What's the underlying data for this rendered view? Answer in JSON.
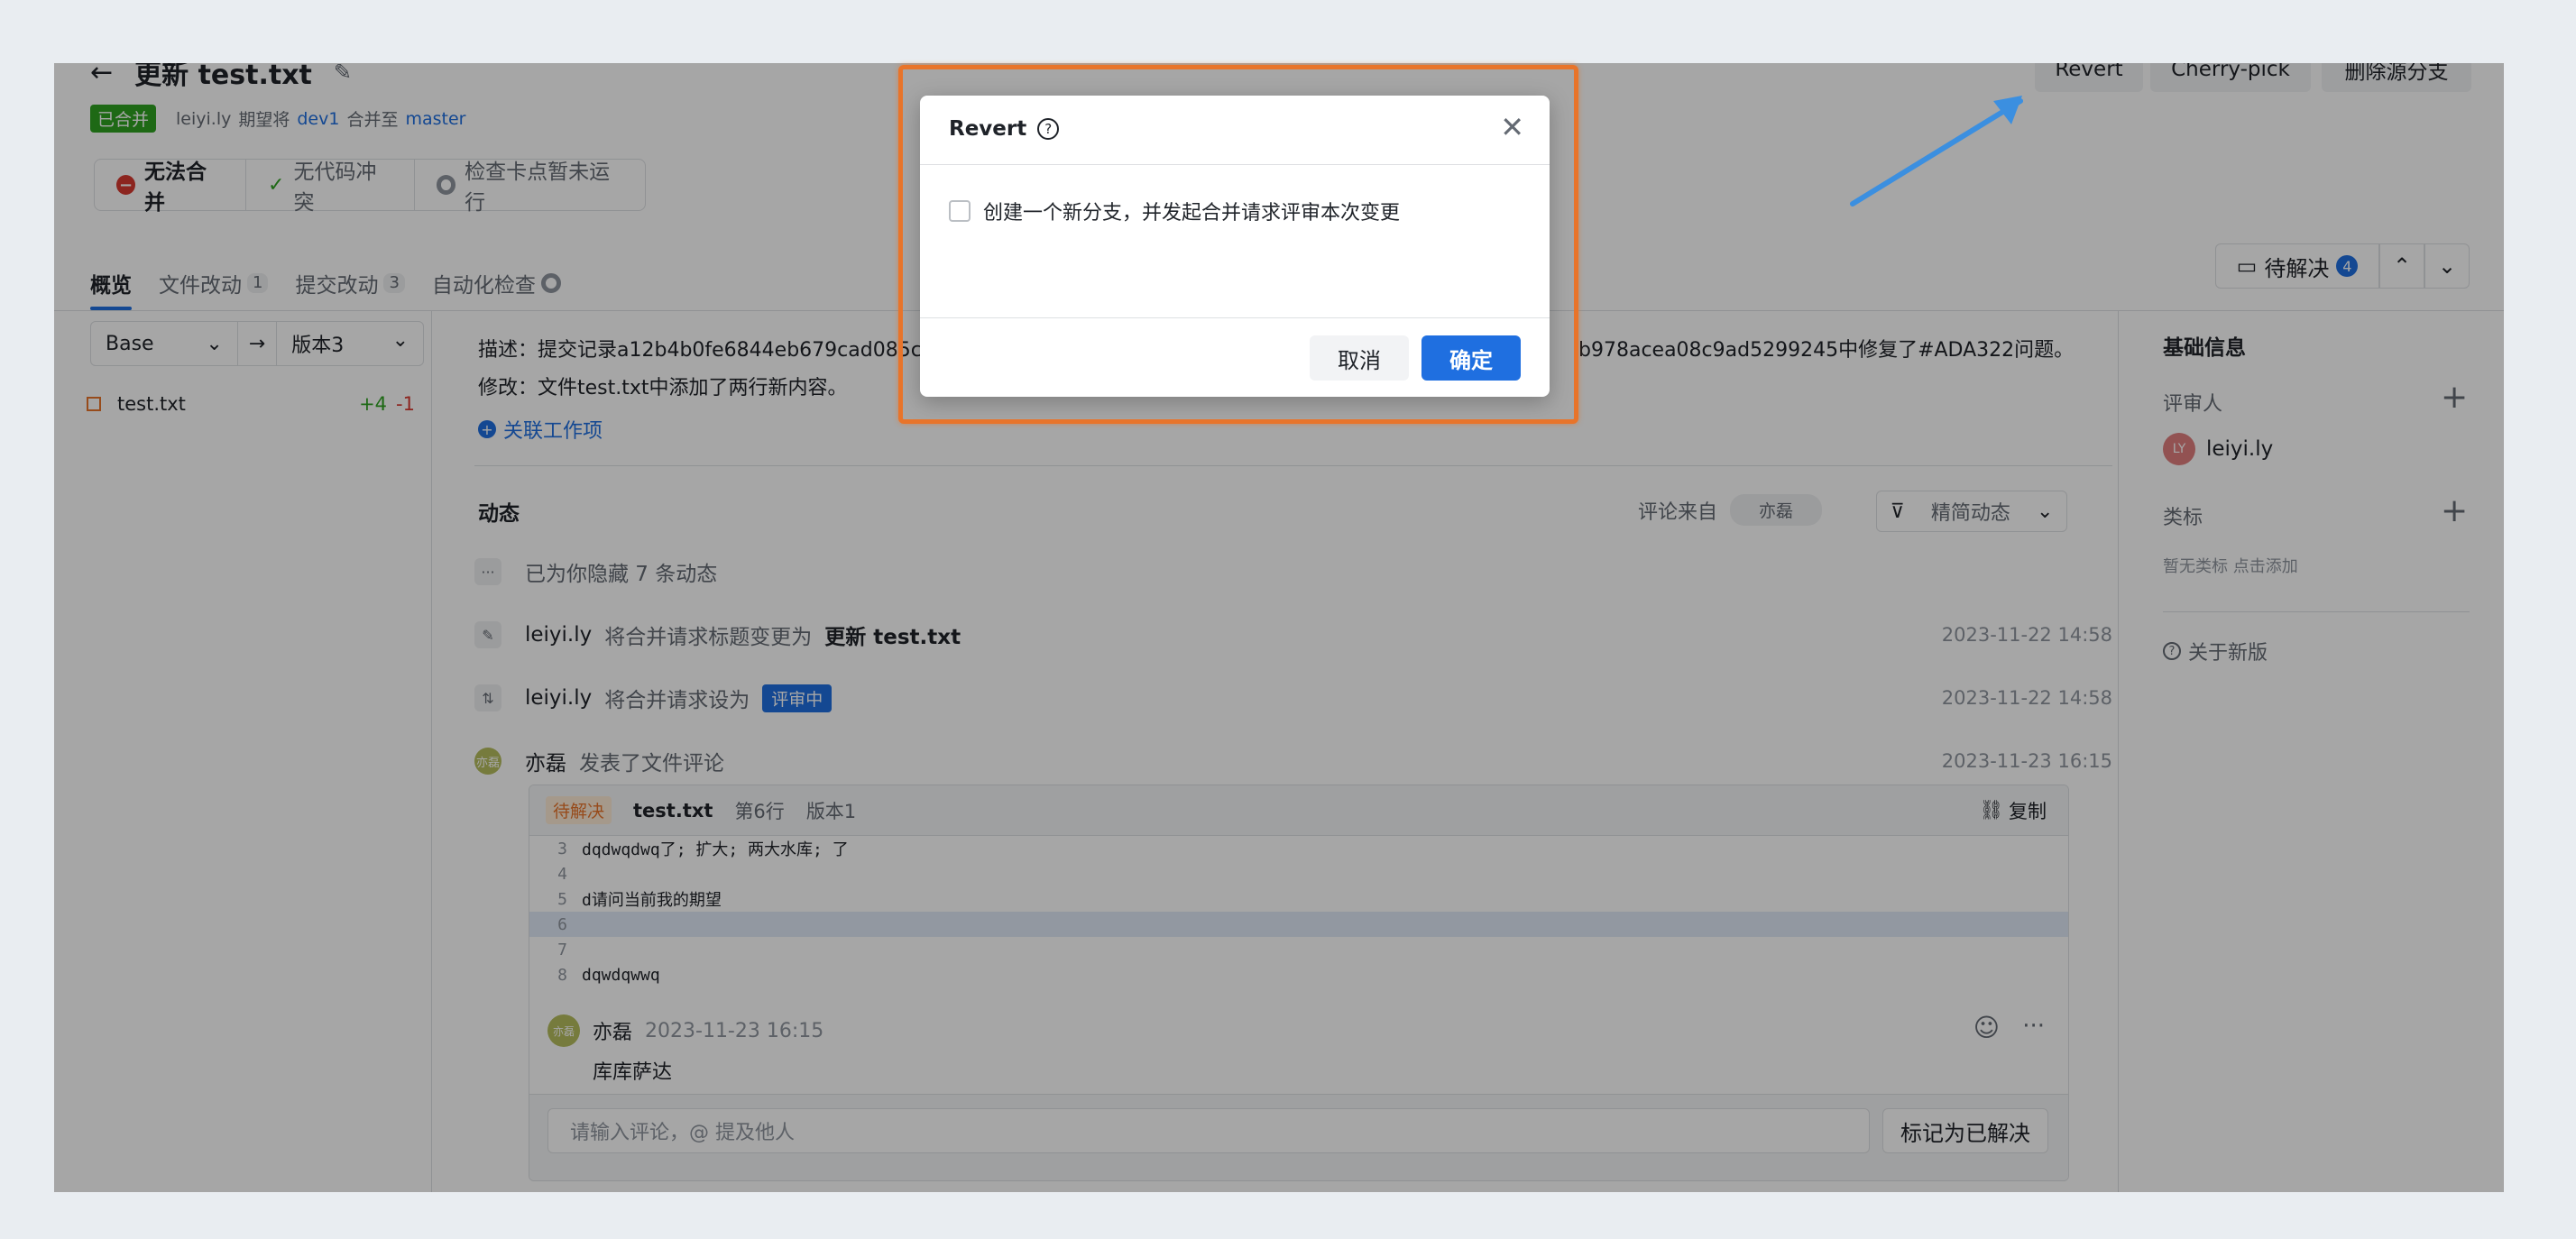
{
  "header": {
    "back_icon": "arrow-left-icon",
    "title": "更新 test.txt",
    "edit_icon": "edit-icon",
    "status_badge": "已合并",
    "author": "leiyi.ly",
    "merge_text_1": "期望将",
    "source_branch": "dev1",
    "merge_text_2": "合并至",
    "target_branch": "master"
  },
  "actions": {
    "revert": "Revert",
    "cherry_pick": "Cherry-pick",
    "delete_branch": "删除源分支"
  },
  "checks": {
    "cannot_merge": "无法合并",
    "no_conflict": "无代码冲突",
    "checkpoint": "检查卡点暂未运行"
  },
  "tabs": [
    {
      "label": "概览",
      "count": ""
    },
    {
      "label": "文件改动",
      "count": "1"
    },
    {
      "label": "提交改动",
      "count": "3"
    },
    {
      "label": "自动化检查",
      "count": ""
    }
  ],
  "pending": {
    "label": "待解决",
    "count": "4"
  },
  "compare": {
    "base": "Base",
    "arrow": "→",
    "version": "版本3"
  },
  "files": [
    {
      "name": "test.txt",
      "added": "+4",
      "removed": "-1"
    }
  ],
  "description": {
    "line1_left": "描述：提交记录a12b4b0fe6844eb679cad085c",
    "line1_right": "b978acea08c9ad5299245中修复了#ADA322问题。",
    "line2": "修改：文件test.txt中添加了两行新内容。",
    "link_work_item": "关联工作项"
  },
  "activity": {
    "title": "动态",
    "comment_from": "评论来自",
    "comment_from_user": "亦磊",
    "filter": "精简动态",
    "hidden": "已为你隐藏 7 条动态",
    "items": [
      {
        "user": "leiyi.ly",
        "text": "将合并请求标题变更为",
        "bold": "更新 test.txt",
        "time": "2023-11-22 14:58"
      },
      {
        "user": "leiyi.ly",
        "text": "将合并请求设为",
        "tag": "评审中",
        "time": "2023-11-22 14:58"
      },
      {
        "user": "亦磊",
        "text": "发表了文件评论",
        "time": "2023-11-23 16:15"
      }
    ]
  },
  "code_comment": {
    "status": "待解决",
    "file": "test.txt",
    "line": "第6行",
    "version": "版本1",
    "copy": "复制",
    "lines": [
      {
        "n": "3",
        "t": "dqdwqdwq了; 扩大; 两大水库; 了"
      },
      {
        "n": "4",
        "t": ""
      },
      {
        "n": "5",
        "t": "d请问当前我的期望"
      },
      {
        "n": "6",
        "t": ""
      },
      {
        "n": "7",
        "t": ""
      },
      {
        "n": "8",
        "t": "dqwdqwwq"
      }
    ],
    "comment_user": "亦磊",
    "comment_time": "2023-11-23 16:15",
    "comment_text": "库库萨达",
    "input_placeholder": "请输入评论，@ 提及他人",
    "resolve": "标记为已解决"
  },
  "sidebar": {
    "basic_info": "基础信息",
    "reviewers": "评审人",
    "reviewer_name": "leiyi.ly",
    "labels": "类标",
    "labels_empty": "暂无类标 点击添加",
    "about": "关于新版"
  },
  "dialog": {
    "title": "Revert",
    "checkbox_label": "创建一个新分支，并发起合并请求评审本次变更",
    "cancel": "取消",
    "confirm": "确定"
  },
  "colors": {
    "accent": "#1f6fe0",
    "success": "#2ea121",
    "danger": "#d83931",
    "highlight": "#e8742a",
    "arrow": "#3b8fe0"
  }
}
